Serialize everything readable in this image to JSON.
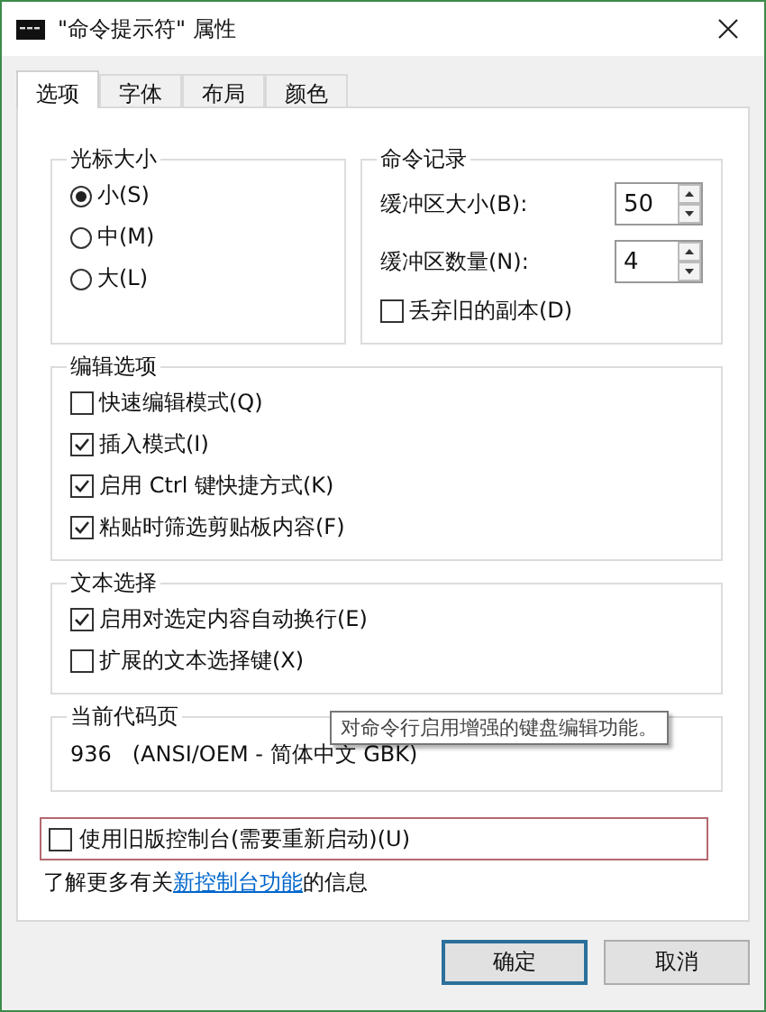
{
  "window": {
    "title": "\"命令提示符\" 属性"
  },
  "tabs": [
    {
      "label": "选项",
      "selected": true
    },
    {
      "label": "字体",
      "selected": false
    },
    {
      "label": "布局",
      "selected": false
    },
    {
      "label": "颜色",
      "selected": false
    }
  ],
  "cursor_size": {
    "title": "光标大小",
    "options": [
      {
        "label": "小(S)",
        "selected": true
      },
      {
        "label": "中(M)",
        "selected": false
      },
      {
        "label": "大(L)",
        "selected": false
      }
    ]
  },
  "command_history": {
    "title": "命令记录",
    "fields": [
      {
        "label": "缓冲区大小(B):",
        "value": "50"
      },
      {
        "label": "缓冲区数量(N):",
        "value": "4"
      }
    ],
    "discard": {
      "label": "丢弃旧的副本(D)",
      "checked": false
    }
  },
  "edit_options": {
    "title": "编辑选项",
    "items": [
      {
        "label": "快速编辑模式(Q)",
        "checked": false
      },
      {
        "label": "插入模式(I)",
        "checked": true
      },
      {
        "label": "启用 Ctrl 键快捷方式(K)",
        "checked": true
      },
      {
        "label": "粘贴时筛选剪贴板内容(F)",
        "checked": true
      }
    ]
  },
  "text_selection": {
    "title": "文本选择",
    "items": [
      {
        "label": "启用对选定内容自动换行(E)",
        "checked": true
      },
      {
        "label": "扩展的文本选择键(X)",
        "checked": false
      }
    ]
  },
  "code_page": {
    "title": "当前代码页",
    "value": "936   (ANSI/OEM - 简体中文 GBK)"
  },
  "tooltip": "对命令行启用增强的键盘编辑功能。",
  "legacy": {
    "label": "使用旧版控制台(需要重新启动)(U)",
    "checked": false
  },
  "info": {
    "before": "了解更多有关",
    "link": "新控制台功能",
    "after": "的信息"
  },
  "buttons": [
    {
      "label": "确定",
      "focused": true
    },
    {
      "label": "取消",
      "focused": false
    }
  ]
}
